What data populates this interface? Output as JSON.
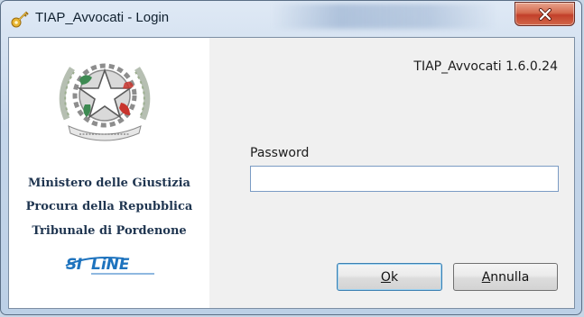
{
  "window": {
    "title": "TIAP_Avvocati - Login",
    "app_icon": "keys-icon",
    "close_icon": "close-icon"
  },
  "left_panel": {
    "emblem_icon": "italian-republic-emblem",
    "ministry_lines": [
      "Ministero delle Giustizia",
      "Procura della Repubblica",
      "Tribunale di Pordenone"
    ],
    "vendor_logo": "siline-logo"
  },
  "right_panel": {
    "version": "TIAP_Avvocati 1.6.0.24",
    "password_label": "Password",
    "password_value": ""
  },
  "buttons": {
    "ok": {
      "accel": "O",
      "rest": "k"
    },
    "cancel": {
      "accel": "A",
      "rest": "nnulla"
    }
  },
  "colors": {
    "titlebar": "#c5d6ea",
    "close_button": "#c2402a",
    "ministry_text": "#1f3550",
    "logo_blue": "#1e73be",
    "emblem_green": "#3d8a52",
    "emblem_red": "#c8342d"
  }
}
